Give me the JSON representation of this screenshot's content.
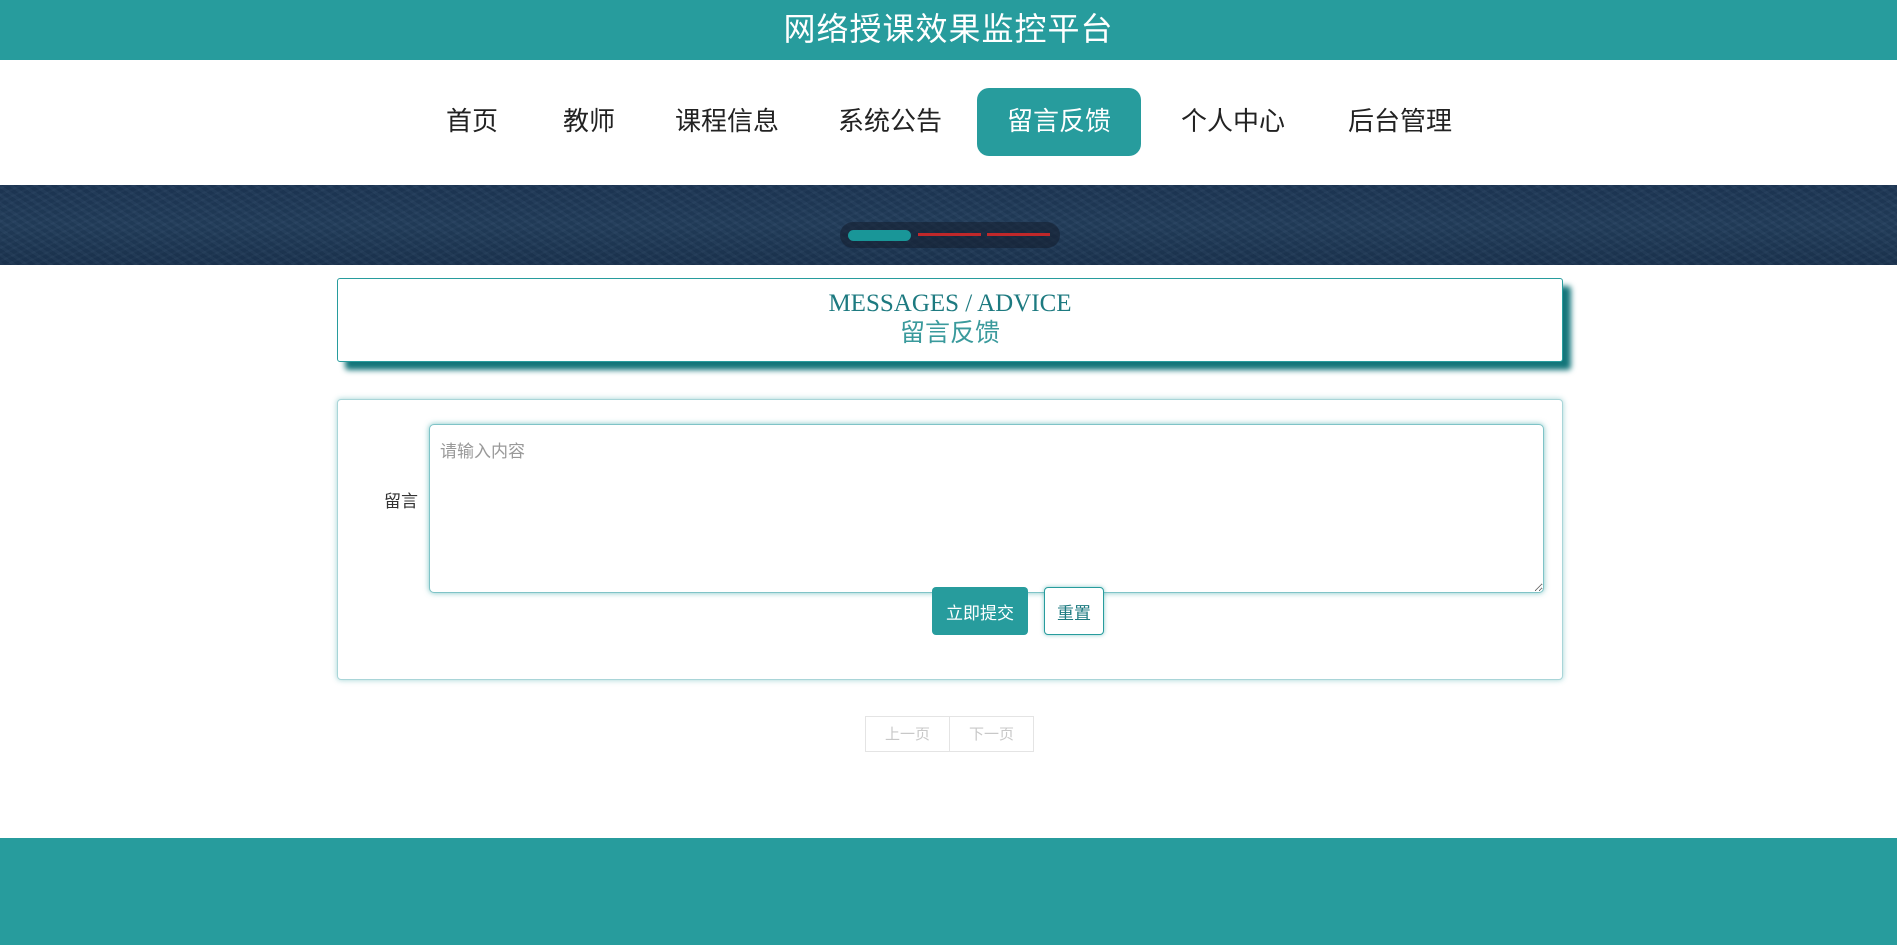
{
  "header": {
    "title": "网络授课效果监控平台"
  },
  "nav": {
    "items": [
      {
        "label": "首页"
      },
      {
        "label": "教师"
      },
      {
        "label": "课程信息"
      },
      {
        "label": "系统公告"
      },
      {
        "label": "留言反馈"
      },
      {
        "label": "个人中心"
      },
      {
        "label": "后台管理"
      }
    ],
    "active_index": 4
  },
  "banner": {
    "slide_count": 3,
    "active_slide": 0
  },
  "section_heading": {
    "en": "MESSAGES / ADVICE",
    "cn": "留言反馈"
  },
  "form": {
    "label": "留言",
    "placeholder": "请输入内容",
    "value": "",
    "submit_label": "立即提交",
    "reset_label": "重置"
  },
  "pagination": {
    "prev_label": "上一页",
    "next_label": "下一页"
  },
  "colors": {
    "primary": "#279c9d",
    "banner": "#1d3655",
    "indicator_inactive": "#c0282a"
  }
}
